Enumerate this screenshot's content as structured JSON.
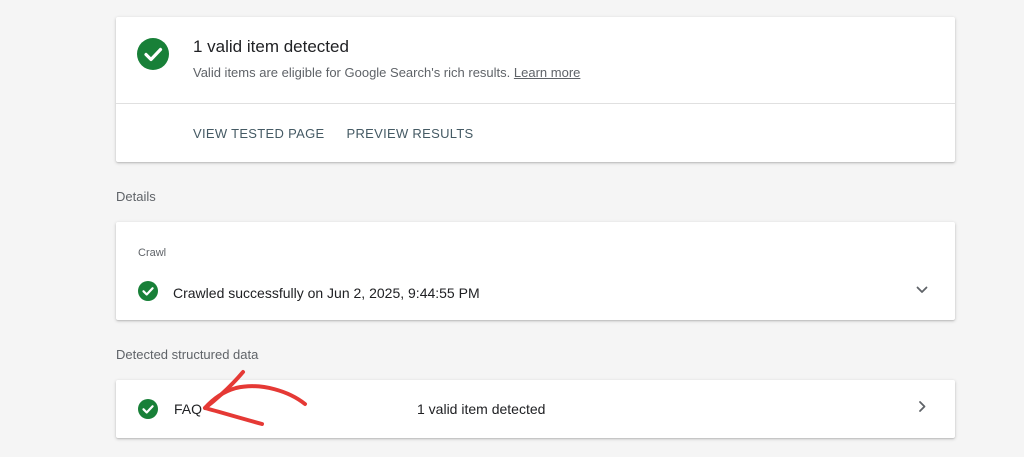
{
  "summary": {
    "title": "1 valid item detected",
    "subtitle": "Valid items are eligible for Google Search's rich results.",
    "learn_more": "Learn more",
    "actions": {
      "view_tested_page": "VIEW TESTED PAGE",
      "preview_results": "PREVIEW RESULTS"
    },
    "icon": "check-circle-icon"
  },
  "details": {
    "section_label": "Details",
    "crawl": {
      "label": "Crawl",
      "status_text": "Crawled successfully on Jun 2, 2025, 9:44:55 PM",
      "icon": "check-circle-icon",
      "expand_icon": "chevron-down-icon"
    }
  },
  "structured_data": {
    "section_label": "Detected structured data",
    "items": [
      {
        "name": "FAQ",
        "status": "1 valid item detected",
        "icon": "check-circle-icon",
        "nav_icon": "chevron-right-icon"
      }
    ]
  },
  "colors": {
    "success": "#188038",
    "background": "#f5f5f5",
    "card": "#ffffff",
    "action_text": "#455a64",
    "annotation": "#e53935"
  }
}
